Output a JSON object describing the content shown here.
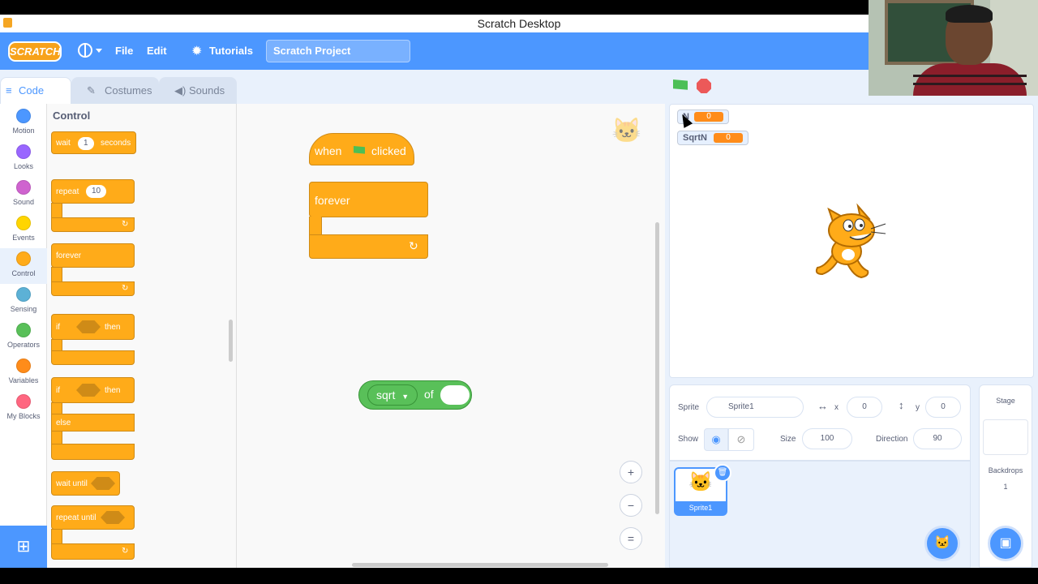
{
  "window": {
    "title": "Scratch Desktop"
  },
  "menubar": {
    "logo": "SCRATCH",
    "file": "File",
    "edit": "Edit",
    "tutorials": "Tutorials",
    "project_title": "Scratch Project"
  },
  "tabs": [
    {
      "label": "Code"
    },
    {
      "label": "Costumes"
    },
    {
      "label": "Sounds"
    }
  ],
  "categories": [
    {
      "label": "Motion",
      "color": "#4c97ff"
    },
    {
      "label": "Looks",
      "color": "#9966ff"
    },
    {
      "label": "Sound",
      "color": "#cf63cf"
    },
    {
      "label": "Events",
      "color": "#ffd500"
    },
    {
      "label": "Control",
      "color": "#ffab19"
    },
    {
      "label": "Sensing",
      "color": "#5cb1d6"
    },
    {
      "label": "Operators",
      "color": "#59c059"
    },
    {
      "label": "Variables",
      "color": "#ff8c1a"
    },
    {
      "label": "My Blocks",
      "color": "#ff6680"
    }
  ],
  "palette": {
    "title": "Control",
    "wait": {
      "label": "wait",
      "value": "1",
      "unit": "seconds"
    },
    "repeat": {
      "label": "repeat",
      "value": "10"
    },
    "forever": "forever",
    "if_then": {
      "if": "if",
      "then": "then"
    },
    "if_else": {
      "if": "if",
      "then": "then",
      "else": "else"
    },
    "wait_until": "wait until",
    "repeat_until": "repeat until"
  },
  "script": {
    "hat": {
      "when": "when",
      "clicked": "clicked"
    },
    "forever": "forever",
    "operator": {
      "func": "sqrt",
      "of": "of"
    }
  },
  "zoom": {
    "in": "+",
    "out": "−",
    "reset": "="
  },
  "monitors": [
    {
      "name": "N",
      "value": "0"
    },
    {
      "name": "SqrtN",
      "value": "0"
    }
  ],
  "sprite_info": {
    "sprite_label": "Sprite",
    "sprite_name": "Sprite1",
    "x_label": "x",
    "x_value": "0",
    "y_label": "y",
    "y_value": "0",
    "show_label": "Show",
    "size_label": "Size",
    "size_value": "100",
    "direction_label": "Direction",
    "direction_value": "90"
  },
  "sprites": [
    {
      "name": "Sprite1"
    }
  ],
  "stage_panel": {
    "title": "Stage",
    "backdrops_label": "Backdrops",
    "backdrops_count": "1"
  },
  "colors": {
    "accent": "#4c97ff",
    "control": "#ffab19",
    "operators": "#59c059",
    "variables": "#ff8c1a"
  }
}
